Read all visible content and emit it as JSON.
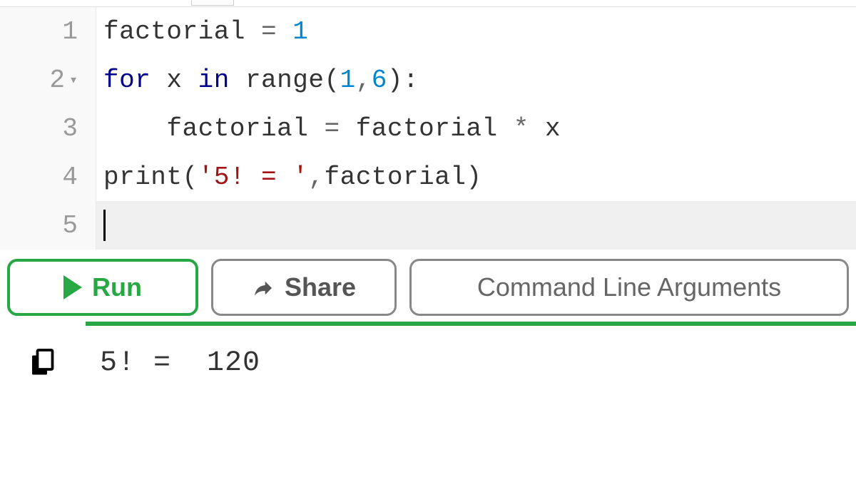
{
  "code": {
    "lines": [
      {
        "n": "1",
        "fold": false,
        "tokens": [
          {
            "t": "factorial ",
            "c": "tok-name"
          },
          {
            "t": "= ",
            "c": "tok-op"
          },
          {
            "t": "1",
            "c": "tok-num"
          }
        ]
      },
      {
        "n": "2",
        "fold": true,
        "tokens": [
          {
            "t": "for",
            "c": "tok-kw"
          },
          {
            "t": " x ",
            "c": "tok-name"
          },
          {
            "t": "in",
            "c": "tok-kw"
          },
          {
            "t": " range",
            "c": "tok-name"
          },
          {
            "t": "(",
            "c": "tok-paren"
          },
          {
            "t": "1",
            "c": "tok-num"
          },
          {
            "t": ",",
            "c": "tok-op"
          },
          {
            "t": "6",
            "c": "tok-num"
          },
          {
            "t": "):",
            "c": "tok-paren"
          }
        ]
      },
      {
        "n": "3",
        "fold": false,
        "tokens": [
          {
            "t": "    factorial ",
            "c": "tok-name"
          },
          {
            "t": "= ",
            "c": "tok-op"
          },
          {
            "t": "factorial ",
            "c": "tok-name"
          },
          {
            "t": "* ",
            "c": "tok-op"
          },
          {
            "t": "x",
            "c": "tok-name"
          }
        ]
      },
      {
        "n": "4",
        "fold": false,
        "tokens": [
          {
            "t": "print",
            "c": "tok-name"
          },
          {
            "t": "(",
            "c": "tok-paren"
          },
          {
            "t": "'5! = '",
            "c": "tok-str"
          },
          {
            "t": ",",
            "c": "tok-op"
          },
          {
            "t": "factorial",
            "c": "tok-name"
          },
          {
            "t": ")",
            "c": "tok-paren"
          }
        ]
      },
      {
        "n": "5",
        "fold": false,
        "current": true,
        "tokens": []
      }
    ]
  },
  "toolbar": {
    "run": "Run",
    "share": "Share",
    "args": "Command Line Arguments"
  },
  "output": {
    "text": "5! =  120"
  }
}
